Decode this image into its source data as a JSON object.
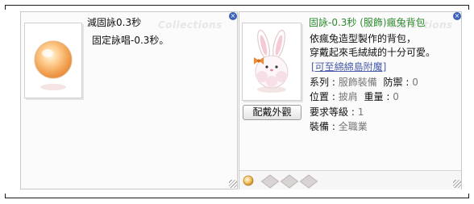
{
  "left_tooltip": {
    "title": "減固詠0.3秒",
    "watermark": "Collections",
    "description": "固定詠唱-0.3秒。",
    "close_icon": "close-icon"
  },
  "right_tooltip": {
    "title": "固詠-0.3秒 (服飾)瘋兔背包",
    "watermark": "Collections",
    "description_lines": [
      "依瘋兔造型製作的背包，",
      "穿戴起來毛絨絨的十分可愛。"
    ],
    "link_text": "[可至綿綿島附魔]",
    "stats": {
      "type_label": "系列 : ",
      "type_value": "服飾裝備",
      "defense_label": "防禦 : ",
      "defense_value": "0",
      "position_label": "位置 : ",
      "position_value": "披肩",
      "weight_label": "重量 : ",
      "weight_value": "0",
      "level_label": "要求等級 : ",
      "level_value": "1",
      "equip_label": "裝備 : ",
      "equip_value": "全職業"
    },
    "preview_button": "配戴外觀",
    "title_color": "#2e8b2e",
    "close_icon": "close-icon"
  }
}
